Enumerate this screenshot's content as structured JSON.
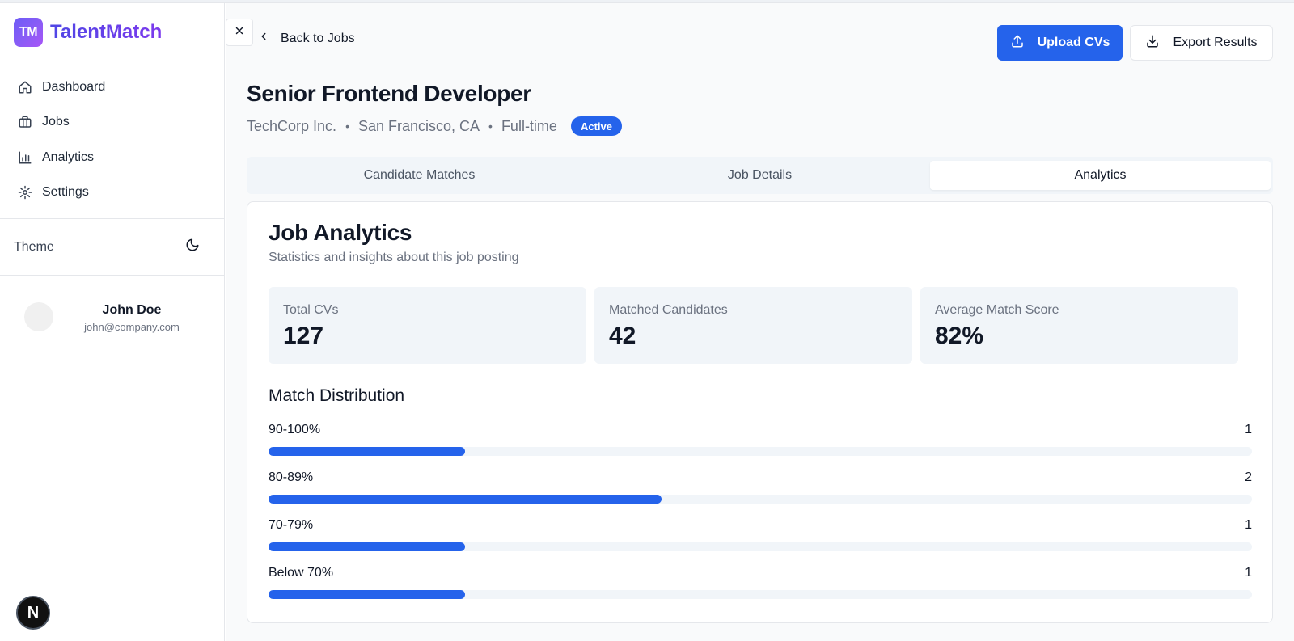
{
  "app": {
    "logo_text": "TM",
    "name": "TalentMatch"
  },
  "sidebar": {
    "items": [
      {
        "label": "Dashboard",
        "icon": "home-icon"
      },
      {
        "label": "Jobs",
        "icon": "briefcase-icon"
      },
      {
        "label": "Analytics",
        "icon": "bar-chart-icon"
      },
      {
        "label": "Settings",
        "icon": "gear-icon"
      }
    ],
    "theme_label": "Theme",
    "theme_icon": "moon-icon",
    "user": {
      "name": "John Doe",
      "email": "john@company.com"
    },
    "corner_badge": "N"
  },
  "header": {
    "back_label": "Back to Jobs",
    "upload_label": "Upload CVs",
    "export_label": "Export Results"
  },
  "job": {
    "title": "Senior Frontend Developer",
    "company": "TechCorp Inc.",
    "location": "San Francisco, CA",
    "type": "Full-time",
    "separator": "•",
    "status": "Active"
  },
  "tabs": [
    {
      "label": "Candidate Matches",
      "active": false
    },
    {
      "label": "Job Details",
      "active": false
    },
    {
      "label": "Analytics",
      "active": true
    }
  ],
  "analytics": {
    "title": "Job Analytics",
    "subtitle": "Statistics and insights about this job posting",
    "stats": [
      {
        "label": "Total CVs",
        "value": "127"
      },
      {
        "label": "Matched Candidates",
        "value": "42"
      },
      {
        "label": "Average Match Score",
        "value": "82%"
      }
    ],
    "distribution_title": "Match Distribution",
    "distribution": [
      {
        "label": "90-100%",
        "count": "1",
        "fill": 0.2
      },
      {
        "label": "80-89%",
        "count": "2",
        "fill": 0.4
      },
      {
        "label": "70-79%",
        "count": "1",
        "fill": 0.2
      },
      {
        "label": "Below 70%",
        "count": "1",
        "fill": 0.2
      }
    ]
  },
  "colors": {
    "accent": "#2563eb",
    "brand_start": "#6d5cf6",
    "brand_end": "#a855f7",
    "track": "#f1f5f9"
  }
}
